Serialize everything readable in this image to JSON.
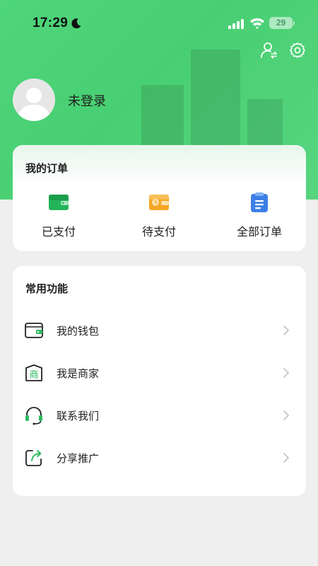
{
  "status_bar": {
    "time": "17:29",
    "battery": "29",
    "icons": [
      "moon-icon",
      "signal-icon",
      "wifi-icon",
      "battery-icon"
    ]
  },
  "header": {
    "icons": [
      "switch-user-icon",
      "settings-icon"
    ],
    "login_status": "未登录"
  },
  "orders": {
    "title": "我的订单",
    "items": [
      {
        "label": "已支付",
        "icon": "wallet-card-icon",
        "color": "#23b45a"
      },
      {
        "label": "待支付",
        "icon": "clock-wallet-icon",
        "color": "#f5a623"
      },
      {
        "label": "全部订单",
        "icon": "clipboard-list-icon",
        "color": "#3d7fe6"
      }
    ]
  },
  "functions": {
    "title": "常用功能",
    "items": [
      {
        "label": "我的钱包",
        "icon": "wallet-icon"
      },
      {
        "label": "我是商家",
        "icon": "merchant-icon",
        "glyph": "商"
      },
      {
        "label": "联系我们",
        "icon": "headset-icon"
      },
      {
        "label": "分享推广",
        "icon": "share-icon"
      }
    ]
  },
  "colors": {
    "accent": "#4fd67a",
    "icon_green": "#2dbb5e",
    "background": "#efefef"
  }
}
